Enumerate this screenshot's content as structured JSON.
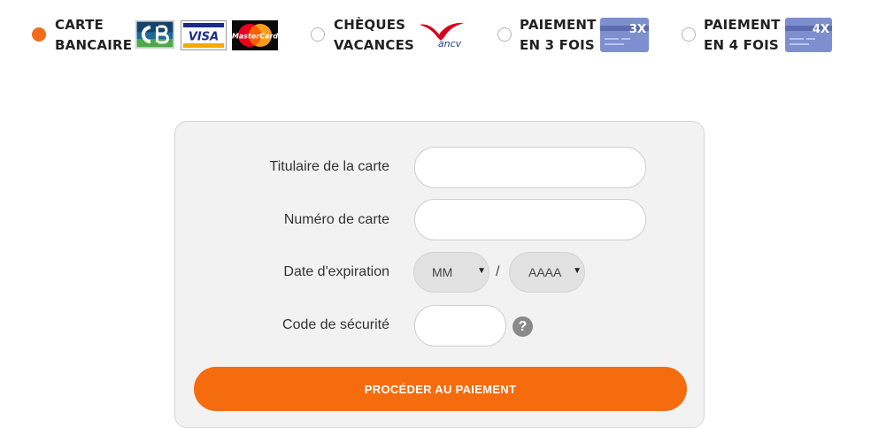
{
  "payment_options": [
    {
      "label_line1": "CARTE",
      "label_line2": "BANCAIRE",
      "selected": true,
      "logos": [
        "cb-logo",
        "visa-logo",
        "mastercard-logo"
      ]
    },
    {
      "label_line1": "CHÈQUES",
      "label_line2": "VACANCES",
      "selected": false,
      "logos": [
        "ancv-logo"
      ]
    },
    {
      "label_line1": "PAIEMENT",
      "label_line2": "EN 3 FOIS",
      "selected": false,
      "logos": [
        "card-3x-icon"
      ]
    },
    {
      "label_line1": "PAIEMENT",
      "label_line2": "EN 4 FOIS",
      "selected": false,
      "logos": [
        "card-4x-icon"
      ]
    }
  ],
  "logo_text": {
    "visa": "VISA",
    "mastercard": "MasterCard",
    "ancv": "ancv",
    "card3": "3X",
    "card4": "4X"
  },
  "form": {
    "cardholder_label": "Titulaire de la carte",
    "cardholder_value": "",
    "card_number_label": "Numéro de carte",
    "card_number_value": "",
    "expiry_label": "Date d'expiration",
    "expiry_month": "MM",
    "expiry_separator": "/",
    "expiry_year": "AAAA",
    "security_code_label": "Code de sécurité",
    "security_code_value": "",
    "help_symbol": "?",
    "submit_label": "PROCÉDER AU PAIEMENT"
  },
  "colors": {
    "accent": "#f26c1c",
    "submit_button": "#f56c0e",
    "panel_background": "#f2f2f2",
    "card_icon": "#7d8fcf"
  }
}
